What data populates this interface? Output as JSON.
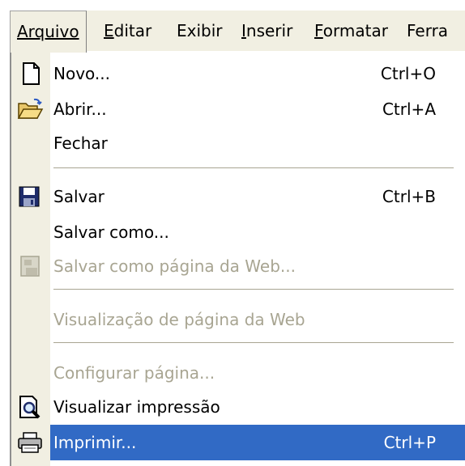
{
  "menubar": {
    "items": [
      {
        "label": "Arquivo"
      },
      {
        "label": "Editar"
      },
      {
        "label": "Exibir"
      },
      {
        "label": "Inserir"
      },
      {
        "label": "Formatar"
      },
      {
        "label": "Ferra"
      }
    ]
  },
  "menu": {
    "items": [
      {
        "label": "Novo...",
        "shortcut": "Ctrl+O",
        "icon": "new-document-icon",
        "state": "enabled"
      },
      {
        "label": "Abrir...",
        "shortcut": "Ctrl+A",
        "icon": "open-folder-icon",
        "state": "enabled"
      },
      {
        "label": "Fechar",
        "shortcut": "",
        "icon": "",
        "state": "enabled"
      },
      {
        "label": "Salvar",
        "shortcut": "Ctrl+B",
        "icon": "save-disk-icon",
        "state": "enabled"
      },
      {
        "label": "Salvar como...",
        "shortcut": "",
        "icon": "",
        "state": "enabled"
      },
      {
        "label": "Salvar como página da Web...",
        "shortcut": "",
        "icon": "save-web-page-icon",
        "state": "disabled"
      },
      {
        "label": "Visualização de página da Web",
        "shortcut": "",
        "icon": "",
        "state": "disabled"
      },
      {
        "label": "Configurar página...",
        "shortcut": "",
        "icon": "",
        "state": "disabled"
      },
      {
        "label": "Visualizar impressão",
        "shortcut": "",
        "icon": "print-preview-icon",
        "state": "enabled"
      },
      {
        "label": "Imprimir...",
        "shortcut": "Ctrl+P",
        "icon": "printer-icon",
        "state": "selected"
      }
    ]
  },
  "colors": {
    "menu_bg": "#f1efe2",
    "selection": "#316ac5",
    "disabled_text": "#a8a592",
    "separator": "#a8a592"
  }
}
